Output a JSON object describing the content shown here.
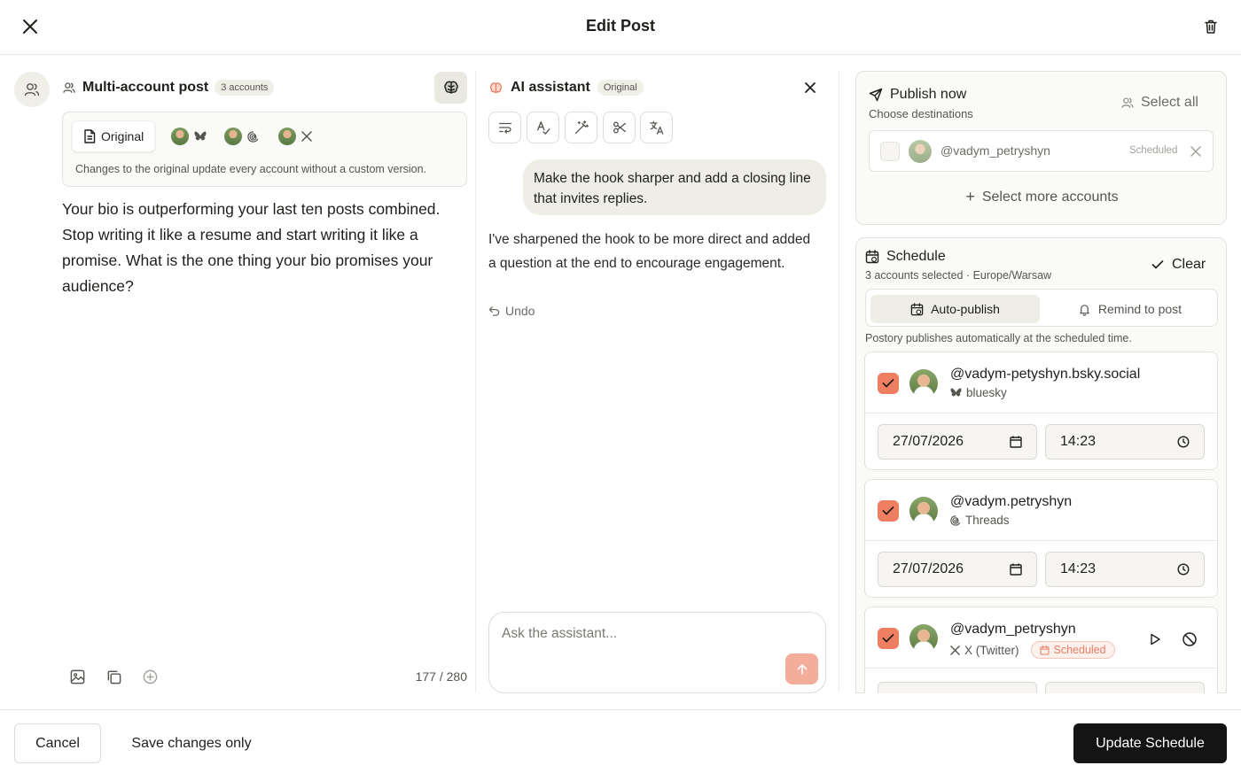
{
  "header": {
    "title": "Edit Post"
  },
  "left": {
    "title": "Multi-account post",
    "accounts_badge": "3 accounts",
    "tabs": [
      {
        "label": "Original",
        "icon": "document-icon"
      },
      {
        "icon": "bluesky-icon"
      },
      {
        "icon": "threads-icon"
      },
      {
        "icon": "x-icon"
      }
    ],
    "hint": "Changes to the original update every account without a custom version.",
    "post_text": "Your bio is outperforming your last ten posts combined. Stop writing it like a resume and start writing it like a promise. What is the one thing your bio promises your audience?",
    "char_count": "177 / 280"
  },
  "assistant": {
    "title": "AI assistant",
    "badge": "Original",
    "user_message": "Make the hook sharper and add a closing line that invites replies.",
    "ai_message": "I've sharpened the hook to be more direct and added a question at the end to encourage engagement.",
    "undo_label": "Undo",
    "input_placeholder": "Ask the assistant..."
  },
  "publish": {
    "title": "Publish now",
    "subtitle": "Choose destinations",
    "select_all": "Select all",
    "account": "@vadym_petryshyn",
    "account_status": "Scheduled",
    "select_more": "Select more accounts"
  },
  "schedule": {
    "title": "Schedule",
    "subtitle": "3 accounts selected · Europe/Warsaw",
    "clear_label": "Clear",
    "modes": [
      "Auto-publish",
      "Remind to post"
    ],
    "mode_hint": "Postory publishes automatically at the scheduled time.",
    "accounts": [
      {
        "handle": "@vadym-petyshyn.bsky.social",
        "network": "bluesky",
        "date": "27/07/2026",
        "time": "14:23"
      },
      {
        "handle": "@vadym.petryshyn",
        "network": "Threads",
        "date": "27/07/2026",
        "time": "14:23"
      },
      {
        "handle": "@vadym_petryshyn",
        "network": "X (Twitter)",
        "status": "Scheduled"
      }
    ]
  },
  "footer": {
    "cancel": "Cancel",
    "save": "Save changes only",
    "update": "Update Schedule"
  },
  "colors": {
    "accent": "#f07f61",
    "primary_button": "#141414",
    "panel_bg": "#fafaf8"
  }
}
